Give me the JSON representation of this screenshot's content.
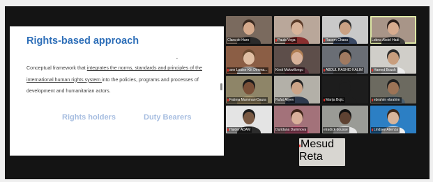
{
  "slide": {
    "title": "Rights-based approach",
    "body_prefix": "Conceptual framework that ",
    "body_underlined": "integrates the norms, standards and principles of the international human rights system ",
    "body_suffix": "into the policies, programs and processes of development and humanitarian actors.",
    "label_left": "Rights holders",
    "label_right": "Duty Bearers"
  },
  "participants": [
    {
      "name": "Clara de Haro",
      "muted": false,
      "bg": "#7a6a5e",
      "skin": "#d5aa8c",
      "hair": "#3a2a20",
      "shirt": "#2b2b2b",
      "active": false
    },
    {
      "name": "Paula Vega",
      "muted": true,
      "bg": "#b9a79a",
      "skin": "#d8b39a",
      "hair": "#5a3a28",
      "shirt": "#8a2f2f",
      "active": false
    },
    {
      "name": "Rasem Chaou",
      "muted": true,
      "bg": "#c9c9c9",
      "skin": "#c9a184",
      "hair": "#2b2b2b",
      "shirt": "#3b4a66",
      "active": false
    },
    {
      "name": "Lobna Abdel Hadi",
      "muted": false,
      "bg": "#a89588",
      "skin": "#d6ab8e",
      "hair": "#2a1e1a",
      "shirt": "#3a3a3a",
      "active": true
    },
    {
      "name": "ann Louise Klit Denma...",
      "muted": true,
      "bg": "#8b5e45",
      "skin": "#e0bfa4",
      "hair": "#6b4a30",
      "shirt": "#ececec",
      "active": false
    },
    {
      "name": "Kirsti Mukwillongo",
      "muted": false,
      "bg": "#5d4e4a",
      "skin": "#d7b19a",
      "hair": "#b07f55",
      "shirt": "#5a2f3a",
      "active": false
    },
    {
      "name": "ABDUL RASHID KALIM",
      "muted": true,
      "bg": "#6a6e75",
      "skin": "#a07a60",
      "hair": "#1e1e1e",
      "shirt": "#4a4a4a",
      "active": false
    },
    {
      "name": "Hamed Boush",
      "muted": true,
      "bg": "#d0cec9",
      "skin": "#c89e7e",
      "hair": "#2a2a2a",
      "shirt": "#ededed",
      "active": false
    },
    {
      "name": "Fatima Mamman-Daura",
      "muted": true,
      "bg": "#8e8568",
      "skin": "#7a5038",
      "hair": "#1a1a1a",
      "shirt": "#c9b27e",
      "active": false
    },
    {
      "name": "Rufat Aliyev",
      "muted": false,
      "bg": "#b3b0a8",
      "skin": "#cba488",
      "hair": "#222222",
      "shirt": "#2e3a4e",
      "active": false
    },
    {
      "name": "Marija Bojic",
      "muted": true,
      "bg": "#1d1d1d",
      "skin": "#1d1d1d",
      "hair": "#1d1d1d",
      "shirt": "#1d1d1d",
      "active": false
    },
    {
      "name": "ebrahim ebrahim",
      "muted": true,
      "bg": "#6c6a60",
      "skin": "#9c7356",
      "hair": "#1e1e1e",
      "shirt": "#4b5e6e",
      "active": false
    },
    {
      "name": "Haider ADAM",
      "muted": true,
      "bg": "#e4e4e4",
      "skin": "#7a5a44",
      "hair": "#1c1c1c",
      "shirt": "#2c2c2c",
      "active": false
    },
    {
      "name": "Duridana Daminova",
      "muted": false,
      "bg": "#a3727a",
      "skin": "#d9b09a",
      "hair": "#3e2418",
      "shirt": "#cf5c7e",
      "active": false
    },
    {
      "name": "elradick dousse",
      "muted": false,
      "bg": "#9a9b96",
      "skin": "#5e4232",
      "hair": "#111111",
      "shirt": "#e6e6e6",
      "active": false
    },
    {
      "name": "Lindsey Atienza",
      "muted": true,
      "bg": "#2c7fc4",
      "skin": "#d7b49a",
      "hair": "#3b2618",
      "shirt": "#f0f0f0",
      "active": false
    }
  ],
  "presenter": {
    "name": "Mesud Reta",
    "muted": true,
    "bg": "#d8d6d1",
    "skin": "#a57a5c",
    "hair": "#1b1b1b",
    "shirt": "#3a3a3a"
  },
  "colors": {
    "accent_title": "#2d6eb8",
    "muted_mic": "#e8302b",
    "active_border": "#dde7a5"
  }
}
